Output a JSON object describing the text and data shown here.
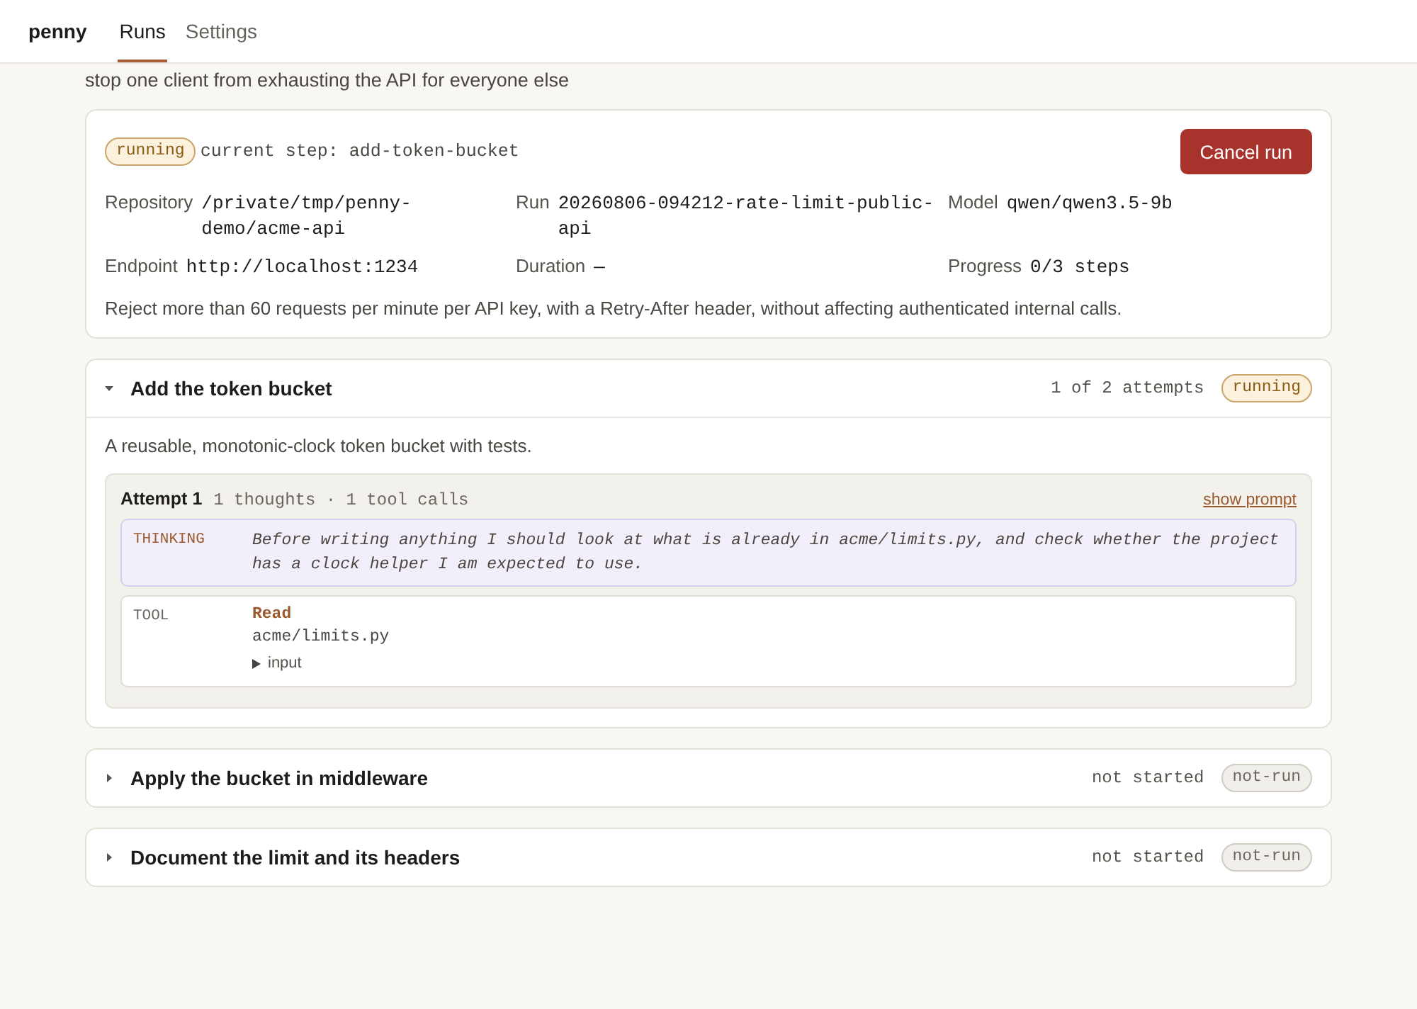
{
  "header": {
    "brand": "penny",
    "tabs": [
      {
        "label": "Runs",
        "selected": true
      },
      {
        "label": "Settings",
        "selected": false
      }
    ]
  },
  "run": {
    "title": "stop one client from exhausting the API for everyone else",
    "status": "running",
    "current_step": "current step: add-token-bucket",
    "cancel_button": "Cancel run",
    "fields": [
      {
        "label": "Repository",
        "value": "/private/tmp/penny-demo/acme-api"
      },
      {
        "label": "Run",
        "value": "20260806-094212-rate-limit-public-api"
      },
      {
        "label": "Model",
        "value": "qwen/qwen3.5-9b"
      },
      {
        "label": "Endpoint",
        "value": "http://localhost:1234"
      },
      {
        "label": "Duration",
        "value": "—"
      },
      {
        "label": "Progress",
        "value": "0/3 steps"
      }
    ],
    "description": "Reject more than 60 requests per minute per API key, with a Retry-After header, without affecting authenticated internal calls."
  },
  "steps": [
    {
      "title": "Add the token bucket",
      "expanded": true,
      "meta": "1 of 2 attempts",
      "status": "running",
      "description": "A reusable, monotonic-clock token bucket with tests.",
      "attempts": [
        {
          "title": "Attempt 1",
          "meta": "1 thoughts · 1 tool calls",
          "link": "show prompt",
          "entries": [
            {
              "kind": "thinking",
              "label": "THINKING",
              "text": "Before writing anything I should look at what is already in acme/limits.py, and check whether the project has a clock helper I am expected to use."
            },
            {
              "kind": "tool",
              "label": "TOOL",
              "tool": "Read",
              "arg": "acme/limits.py",
              "toggle": "input",
              "expanded": false
            }
          ]
        }
      ]
    },
    {
      "title": "Apply the bucket in middleware",
      "expanded": false,
      "meta": "not started",
      "status": "not-run"
    },
    {
      "title": "Document the limit and its headers",
      "expanded": false,
      "meta": "not started",
      "status": "not-run"
    }
  ]
}
